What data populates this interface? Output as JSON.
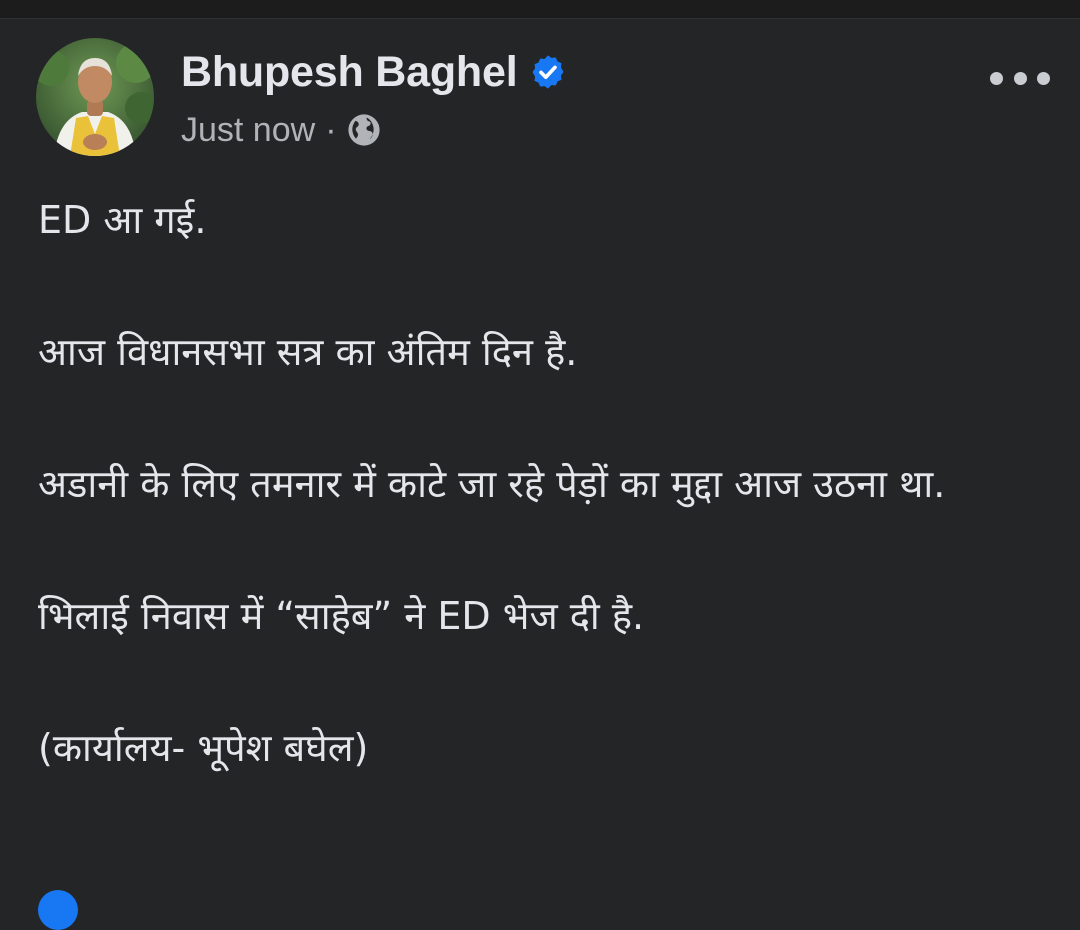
{
  "post": {
    "author": {
      "name": "Bhupesh Baghel",
      "verified": true,
      "avatar_icon": "profile-photo"
    },
    "timestamp": "Just now",
    "separator": "·",
    "audience_icon": "globe-icon",
    "more_icon": "ellipsis-icon",
    "paragraphs": [
      "ED आ गई.",
      "आज विधानसभा सत्र का अंतिम दिन है.",
      "अडानी के लिए तमनार में काटे जा रहे पेड़ों का मुद्दा आज उठना था.",
      "भिलाई निवास में “साहेब” ने ED भेज दी है.",
      "(कार्यालय- भूपेश बघेल)"
    ]
  },
  "colors": {
    "background": "#242526",
    "text_primary": "#e4e6eb",
    "text_secondary": "#b0b3b8",
    "verified_blue": "#1877f2"
  }
}
